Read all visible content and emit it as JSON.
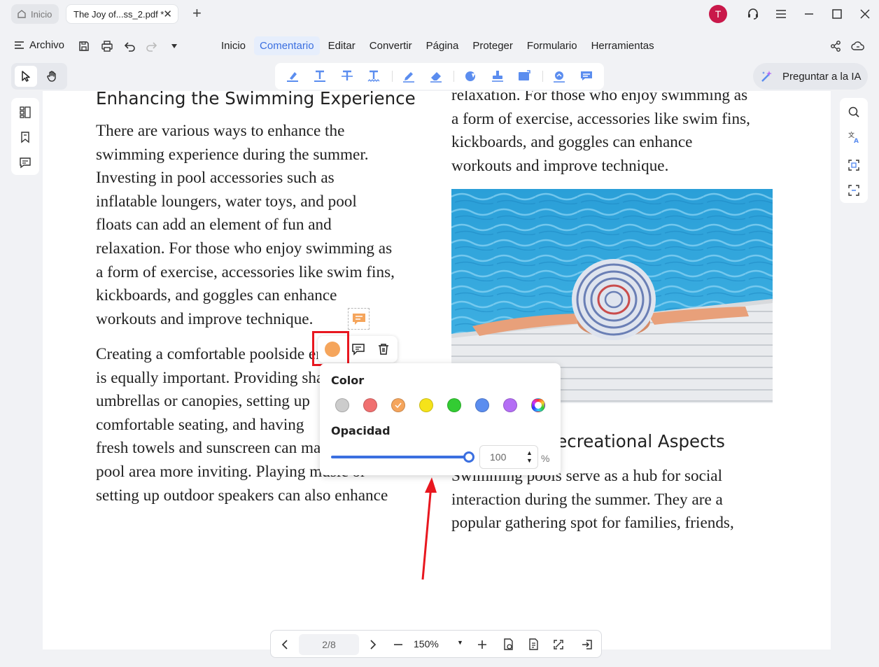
{
  "titlebar": {
    "home_tab": "Inicio",
    "doc_tab": "The Joy of...ss_2.pdf *",
    "avatar_initial": "T"
  },
  "menubar": {
    "file_label": "Archivo",
    "tabs": [
      "Inicio",
      "Comentario",
      "Editar",
      "Convertir",
      "Página",
      "Proteger",
      "Formulario",
      "Herramientas"
    ],
    "active_tab": "Comentario",
    "ai_button": "Preguntar a la IA"
  },
  "document": {
    "left_heading": "Enhancing the Swimming Experience",
    "left_para1": [
      "There are various ways to enhance the",
      "swimming experience during the summer.",
      "Investing in pool accessories such as",
      "inflatable loungers, water toys, and pool",
      "floats can add an element of fun and",
      "relaxation. For those who enjoy swimming as",
      "a form of exercise, accessories like swim fins,",
      "kickboards, and goggles can enhance",
      "workouts and improve technique."
    ],
    "left_para2": [
      "Creating a comfortable poolside environment",
      "is equally important. Providing shade with",
      "umbrellas or canopies, setting up",
      "comfortable seating, and having",
      "fresh towels and sunscreen can make the",
      "pool area more inviting. Playing music or",
      "setting up outdoor speakers can also enhance"
    ],
    "right_para1": [
      "relaxation. For those who enjoy swimming as",
      "a form of exercise, accessories like swim fins,",
      "kickboards, and goggles can enhance",
      "workouts and improve technique."
    ],
    "right_heading": "Social and Recreational Aspects",
    "right_para2": [
      "Swimming pools serve as a hub for social",
      "interaction during the summer. They are a",
      "popular gathering spot for families, friends,"
    ]
  },
  "color_popup": {
    "color_label": "Color",
    "opacity_label": "Opacidad",
    "opacity_value": "100",
    "opacity_unit": "%",
    "swatches": [
      "#cccccc",
      "#f07070",
      "#f5a55c",
      "#f5e31a",
      "#33cc33",
      "#5b8def",
      "#b46ef5",
      "rainbow"
    ],
    "selected_swatch": "#f5a55c",
    "opacity_fraction": 1.0
  },
  "pagination": {
    "page": "2/8",
    "zoom": "150%"
  },
  "colors": {
    "accent": "#3b6fe0",
    "annotation_orange": "#f5a55c",
    "highlight_red": "#e8171f",
    "avatar": "#c9184a"
  }
}
